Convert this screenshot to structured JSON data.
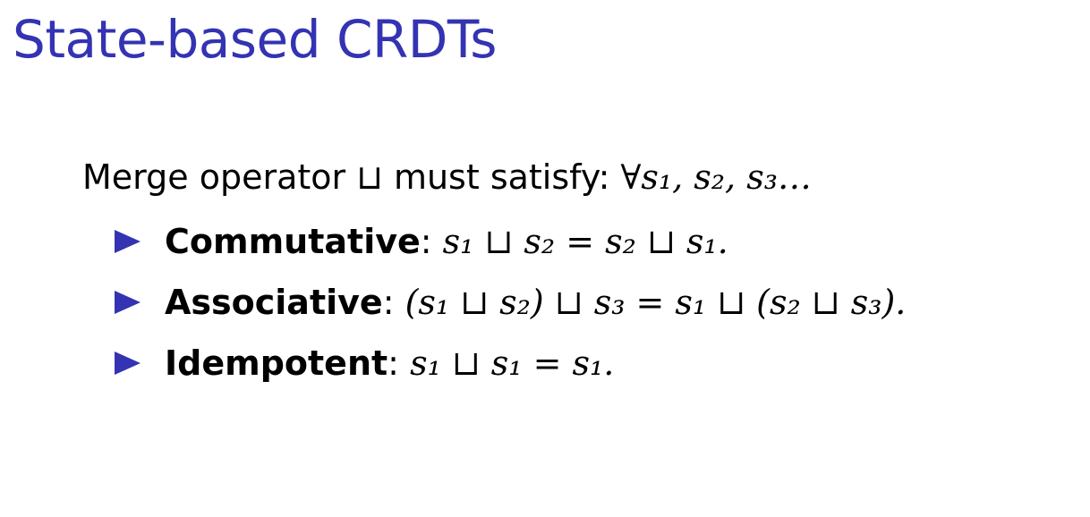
{
  "slide": {
    "title": "State-based CRDTs",
    "intro": {
      "text": "Merge operator ⊔ must satisfy: ",
      "formula": "∀s₁, s₂, s₃…"
    },
    "properties": [
      {
        "name": "Commutative",
        "separator": ": ",
        "formula": "s₁ ⊔ s₂ = s₂ ⊔ s₁."
      },
      {
        "name": "Associative",
        "separator": ": ",
        "formula": "(s₁ ⊔ s₂) ⊔ s₃ = s₁ ⊔ (s₂ ⊔ s₃)."
      },
      {
        "name": "Idempotent",
        "separator": ": ",
        "formula": "s₁ ⊔ s₁ = s₁."
      }
    ],
    "bullet_icon": "triangle-right-icon",
    "colors": {
      "title": "#3333b3",
      "bullet": "#3333b3",
      "text": "#000000",
      "background": "#ffffff"
    }
  }
}
